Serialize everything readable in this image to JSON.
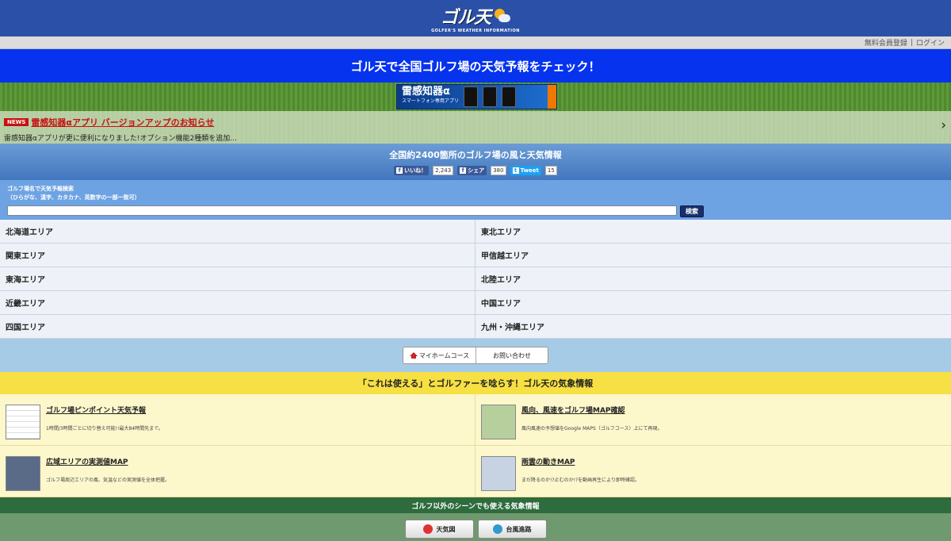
{
  "header": {
    "logo_text": "ゴル天",
    "logo_sub": "GOLFER'S WEATHER INFORMATION"
  },
  "toplinks": {
    "register": "無料会員登録",
    "sep": "|",
    "login": "ログイン"
  },
  "banner": {
    "title": "ゴル天で全国ゴルフ場の天気予報をチェック！"
  },
  "ad": {
    "title": "雷感知器α",
    "sub": "スマートフォン専用アプリ"
  },
  "news": {
    "badge": "NEWS",
    "title": "雷感知器αアプリ バージョンアップのお知らせ",
    "body": "雷感知器αアプリが更に便利になりました!オプション機能2種類を追加...",
    "arrow": "›"
  },
  "intro": {
    "title": "全国約2400箇所のゴルフ場の風と天気情報"
  },
  "social": {
    "like_label": "いいね！",
    "like_count": "2,243",
    "share_label": "シェア",
    "share_count": "380",
    "tweet_label": "Tweet",
    "tweet_count": "15"
  },
  "search": {
    "label1": "ゴルフ場名で天気予報検索",
    "label2": "（ひらがな、漢字、カタカナ、英数字の一部一致可）",
    "value": "",
    "button": "検索"
  },
  "areas": [
    "北海道エリア",
    "東北エリア",
    "関東エリア",
    "甲信越エリア",
    "東海エリア",
    "北陸エリア",
    "近畿エリア",
    "中国エリア",
    "四国エリア",
    "九州・沖縄エリア"
  ],
  "tabs": {
    "home": "マイホームコース",
    "contact": "お問い合わせ"
  },
  "weather": {
    "header": "「これは使える」とゴルファーを唸らす！ゴル天の気象情報",
    "items": [
      {
        "title": "ゴルフ場ピンポイント天気予報",
        "desc": "1時間/3時間ごとに切り替え可能!!最大84時間先まで。"
      },
      {
        "title": "風向、風速をゴルフ場MAP確認",
        "desc": "風向風速の予想値をGoogle MAPS（ゴルフコース）上にて再現。"
      },
      {
        "title": "広域エリアの実測値MAP",
        "desc": "ゴルフ場周辺エリアの風、気温などの実測値を全体把握。"
      },
      {
        "title": "雨雲の動きMAP",
        "desc": "まだ降るのか!?止むのか!?を動画再生により即時確認。"
      }
    ]
  },
  "other": {
    "header": "ゴルフ以外のシーンでも使える気象情報",
    "weather_map": "天気図",
    "typhoon": "台風進路"
  }
}
